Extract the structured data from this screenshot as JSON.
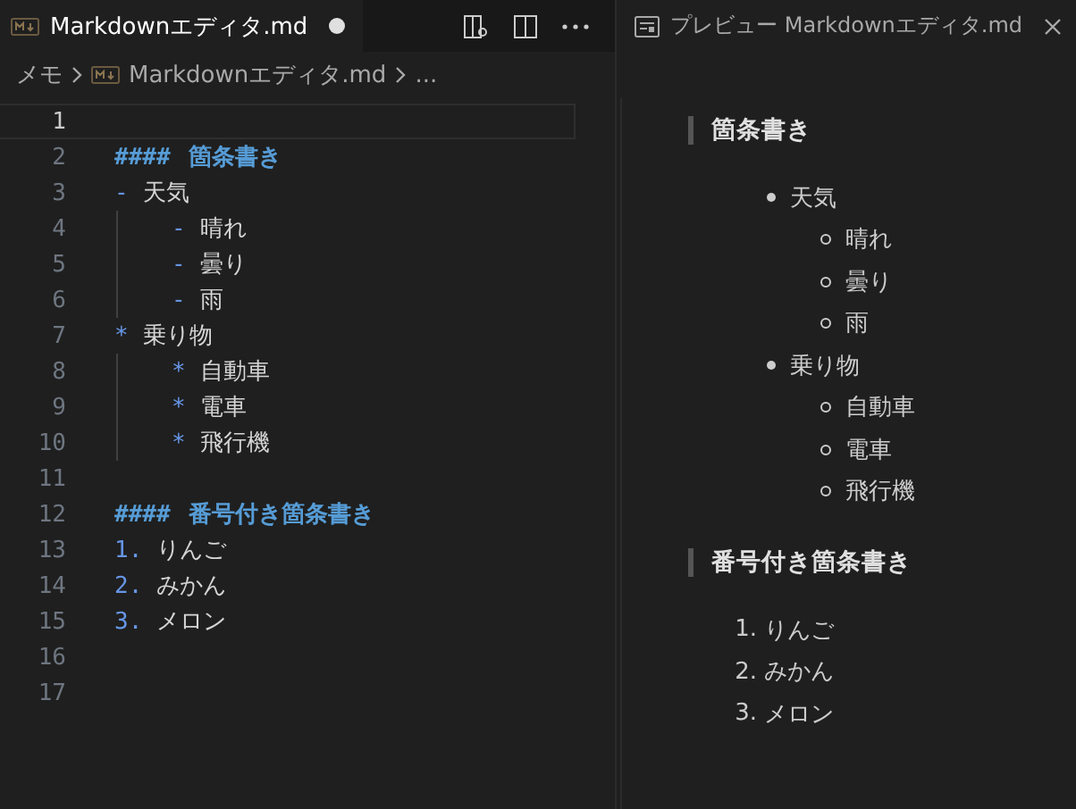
{
  "editor": {
    "tab": {
      "title": "Markdownエディタ.md",
      "modified": true
    },
    "breadcrumbs": [
      {
        "kind": "folder",
        "text": "メモ"
      },
      {
        "kind": "file",
        "text": "Markdownエディタ.md"
      },
      {
        "kind": "more",
        "text": "..."
      }
    ],
    "lines": [
      {
        "number": "1",
        "current": true
      },
      {
        "number": "2",
        "current": false,
        "tokens": [
          {
            "kind": "heading-mark",
            "text": "####"
          },
          {
            "kind": "heading",
            "text": "箇条書き"
          }
        ]
      },
      {
        "number": "3",
        "current": false,
        "tokens": [
          {
            "kind": "marker",
            "text": "-"
          },
          {
            "kind": "text",
            "text": "天気"
          }
        ],
        "children": [
          {
            "number": "4",
            "current": false,
            "tokens": [
              {
                "kind": "marker",
                "text": "-"
              },
              {
                "kind": "text",
                "text": "晴れ"
              }
            ]
          },
          {
            "number": "5",
            "current": false,
            "tokens": [
              {
                "kind": "marker",
                "text": "-"
              },
              {
                "kind": "text",
                "text": "曇り"
              }
            ]
          },
          {
            "number": "6",
            "current": false,
            "tokens": [
              {
                "kind": "marker",
                "text": "-"
              },
              {
                "kind": "text",
                "text": "雨"
              }
            ]
          }
        ]
      },
      {
        "number": "7",
        "current": false,
        "tokens": [
          {
            "kind": "marker",
            "text": "*"
          },
          {
            "kind": "text",
            "text": "乗り物"
          }
        ],
        "children": [
          {
            "number": "8",
            "current": false,
            "tokens": [
              {
                "kind": "marker",
                "text": "*"
              },
              {
                "kind": "text",
                "text": "自動車"
              }
            ]
          },
          {
            "number": "9",
            "current": false,
            "tokens": [
              {
                "kind": "marker",
                "text": "*"
              },
              {
                "kind": "text",
                "text": "電車"
              }
            ]
          },
          {
            "number": "10",
            "current": false,
            "tokens": [
              {
                "kind": "marker",
                "text": "*"
              },
              {
                "kind": "text",
                "text": "飛行機"
              }
            ]
          }
        ]
      },
      {
        "number": "11",
        "current": false
      },
      {
        "number": "12",
        "current": false,
        "tokens": [
          {
            "kind": "heading-mark",
            "text": "####"
          },
          {
            "kind": "heading",
            "text": "番号付き箇条書き"
          }
        ]
      },
      {
        "number": "13",
        "current": false,
        "tokens": [
          {
            "kind": "marker",
            "text": "1."
          },
          {
            "kind": "text",
            "text": "りんご"
          }
        ]
      },
      {
        "number": "14",
        "current": false,
        "tokens": [
          {
            "kind": "marker",
            "text": "2."
          },
          {
            "kind": "text",
            "text": "みかん"
          }
        ]
      },
      {
        "number": "15",
        "current": false,
        "tokens": [
          {
            "kind": "marker",
            "text": "3."
          },
          {
            "kind": "text",
            "text": "メロン"
          }
        ]
      },
      {
        "number": "16",
        "current": false
      },
      {
        "number": "17",
        "current": false
      }
    ]
  },
  "preview": {
    "tab": {
      "title": "プレビュー Markdownエディタ.md"
    },
    "blocks": [
      {
        "kind": "heading",
        "text": "箇条書き"
      },
      {
        "kind": "bullets",
        "items": [
          {
            "text": "天気",
            "children": [
              {
                "text": "晴れ"
              },
              {
                "text": "曇り"
              },
              {
                "text": "雨"
              }
            ]
          },
          {
            "text": "乗り物",
            "children": [
              {
                "text": "自動車"
              },
              {
                "text": "電車"
              },
              {
                "text": "飛行機"
              }
            ]
          }
        ]
      },
      {
        "kind": "heading",
        "text": "番号付き箇条書き"
      },
      {
        "kind": "numbered",
        "items": [
          {
            "marker": "1.",
            "text": "りんご"
          },
          {
            "marker": "2.",
            "text": "みかん"
          },
          {
            "marker": "3.",
            "text": "メロン"
          }
        ]
      }
    ]
  }
}
